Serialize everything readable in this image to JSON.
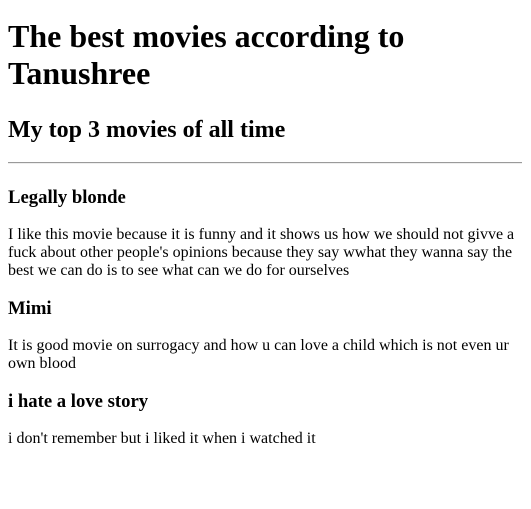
{
  "page": {
    "title": "The best movies according to Tanushree",
    "subtitle": "My top 3 movies of all time"
  },
  "movies": [
    {
      "name": "Legally blonde",
      "description": "I like this movie because it is funny and it shows us how we should not givve a fuck about other people's opinions because they say wwhat they wanna say the best we can do is to see what can we do for ourselves"
    },
    {
      "name": "Mimi",
      "description": "It is good movie on surrogacy and how u can love a child which is not even ur own blood"
    },
    {
      "name": "i hate a love story",
      "description": "i don't remember but i liked it when i watched it"
    }
  ]
}
